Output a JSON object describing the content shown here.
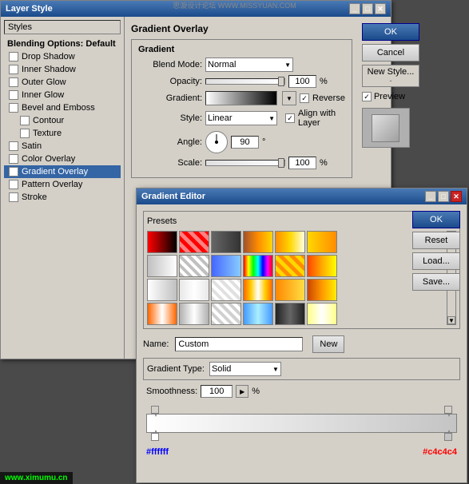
{
  "watermark_top": "思漩设计论坛 WWW.MISSYUAN.COM",
  "watermark_bottom": "www.ximumu.cn",
  "layer_style": {
    "title": "Layer Style",
    "sidebar_title": "Styles",
    "items": [
      {
        "label": "Blending Options: Default",
        "type": "section",
        "checked": false
      },
      {
        "label": "Drop Shadow",
        "type": "check",
        "checked": false
      },
      {
        "label": "Inner Shadow",
        "type": "check",
        "checked": false
      },
      {
        "label": "Outer Glow",
        "type": "check",
        "checked": false
      },
      {
        "label": "Inner Glow",
        "type": "check",
        "checked": false
      },
      {
        "label": "Bevel and Emboss",
        "type": "check",
        "checked": false
      },
      {
        "label": "Contour",
        "type": "subcheck",
        "checked": false
      },
      {
        "label": "Texture",
        "type": "subcheck",
        "checked": false
      },
      {
        "label": "Satin",
        "type": "check",
        "checked": false
      },
      {
        "label": "Color Overlay",
        "type": "check",
        "checked": false
      },
      {
        "label": "Gradient Overlay",
        "type": "check",
        "checked": true,
        "active": true
      },
      {
        "label": "Pattern Overlay",
        "type": "check",
        "checked": false
      },
      {
        "label": "Stroke",
        "type": "check",
        "checked": false
      }
    ],
    "section": "Gradient Overlay",
    "subsection": "Gradient",
    "blend_mode_label": "Blend Mode:",
    "blend_mode_value": "Normal",
    "opacity_label": "Opacity:",
    "opacity_value": "100",
    "opacity_unit": "%",
    "gradient_label": "Gradient:",
    "reverse_label": "Reverse",
    "style_label": "Style:",
    "style_value": "Linear",
    "align_layer_label": "Align with Layer",
    "angle_label": "Angle:",
    "angle_value": "90",
    "angle_unit": "°",
    "scale_label": "Scale:",
    "scale_value": "100",
    "scale_unit": "%",
    "buttons": {
      "ok": "OK",
      "cancel": "Cancel",
      "new_style": "New Style...",
      "preview": "Preview"
    }
  },
  "gradient_editor": {
    "title": "Gradient Editor",
    "presets_label": "Presets",
    "name_label": "Name:",
    "name_value": "Custom",
    "new_button": "New",
    "buttons": {
      "ok": "OK",
      "reset": "Reset",
      "load": "Load...",
      "save": "Save..."
    },
    "gradient_type_label": "Gradient Type:",
    "gradient_type_value": "Solid",
    "smoothness_label": "Smoothness:",
    "smoothness_value": "100",
    "smoothness_unit": "%",
    "color_left": "#ffffff",
    "color_right": "#c4c4c4"
  }
}
